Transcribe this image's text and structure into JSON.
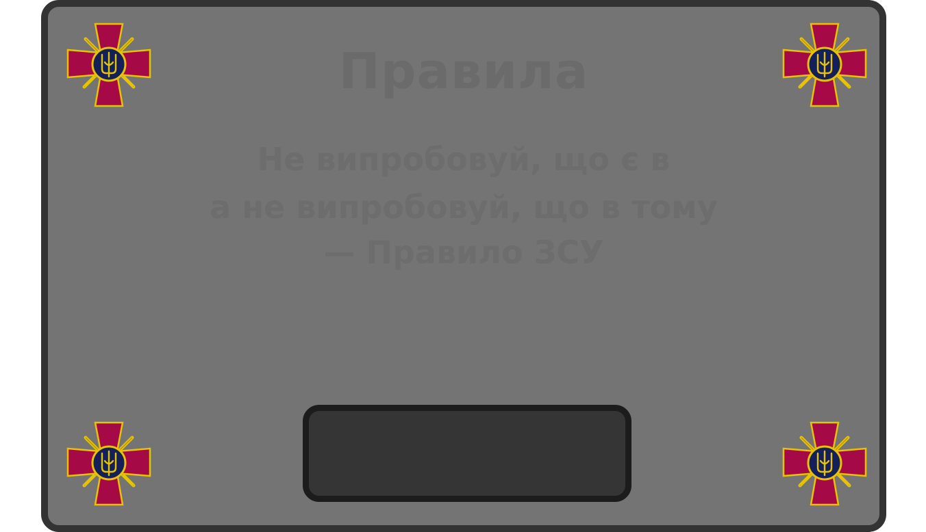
{
  "screen": {
    "title": "Правила",
    "message_lines": [
      "Не випробовуй, що є в",
      "а не випробовуй, що в тому",
      "— Правило ЗСУ"
    ]
  },
  "colors": {
    "panel_bg": "#747474",
    "panel_border": "#333333",
    "cross_red": "#a50a46",
    "cross_gold": "#e8c300",
    "medallion_navy": "#13205a",
    "action_bg": "#353535"
  },
  "icons": {
    "corner_emblem": "armed-forces-cross-icon"
  },
  "action_button": {
    "label": ""
  }
}
